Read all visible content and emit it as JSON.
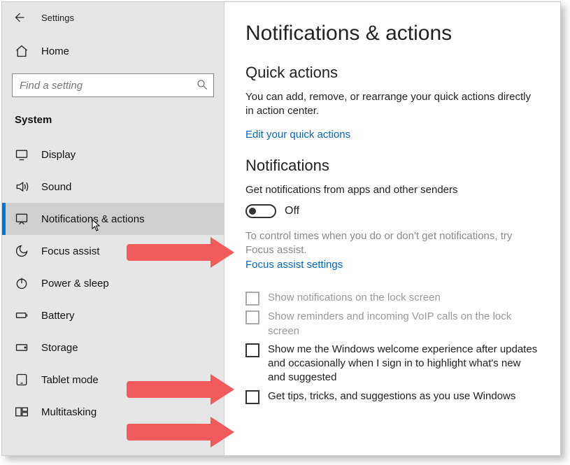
{
  "titlebar": {
    "label": "Settings"
  },
  "home": {
    "label": "Home"
  },
  "search": {
    "placeholder": "Find a setting"
  },
  "section_label": "System",
  "nav": {
    "items": [
      {
        "label": "Display",
        "icon": "display-icon"
      },
      {
        "label": "Sound",
        "icon": "sound-icon"
      },
      {
        "label": "Notifications & actions",
        "icon": "notifications-icon",
        "selected": true
      },
      {
        "label": "Focus assist",
        "icon": "moon-icon"
      },
      {
        "label": "Power & sleep",
        "icon": "power-icon"
      },
      {
        "label": "Battery",
        "icon": "battery-icon"
      },
      {
        "label": "Storage",
        "icon": "storage-icon"
      },
      {
        "label": "Tablet mode",
        "icon": "tablet-icon"
      },
      {
        "label": "Multitasking",
        "icon": "multitask-icon"
      }
    ]
  },
  "page": {
    "title": "Notifications & actions",
    "quick_actions": {
      "heading": "Quick actions",
      "body": "You can add, remove, or rearrange your quick actions directly in action center.",
      "link": "Edit your quick actions"
    },
    "notifications": {
      "heading": "Notifications",
      "toggle_label": "Get notifications from apps and other senders",
      "toggle_state": "Off",
      "focus_text": "To control times when you do or don't get notifications, try Focus assist.",
      "focus_link": "Focus assist settings",
      "checks": [
        {
          "label": "Show notifications on the lock screen",
          "disabled": true
        },
        {
          "label": "Show reminders and incoming VoIP calls on the lock screen",
          "disabled": true
        },
        {
          "label": "Show me the Windows welcome experience after updates and occasionally when I sign in to highlight what's new and suggested",
          "disabled": false
        },
        {
          "label": "Get tips, tricks, and suggestions as you use Windows",
          "disabled": false
        }
      ]
    }
  }
}
